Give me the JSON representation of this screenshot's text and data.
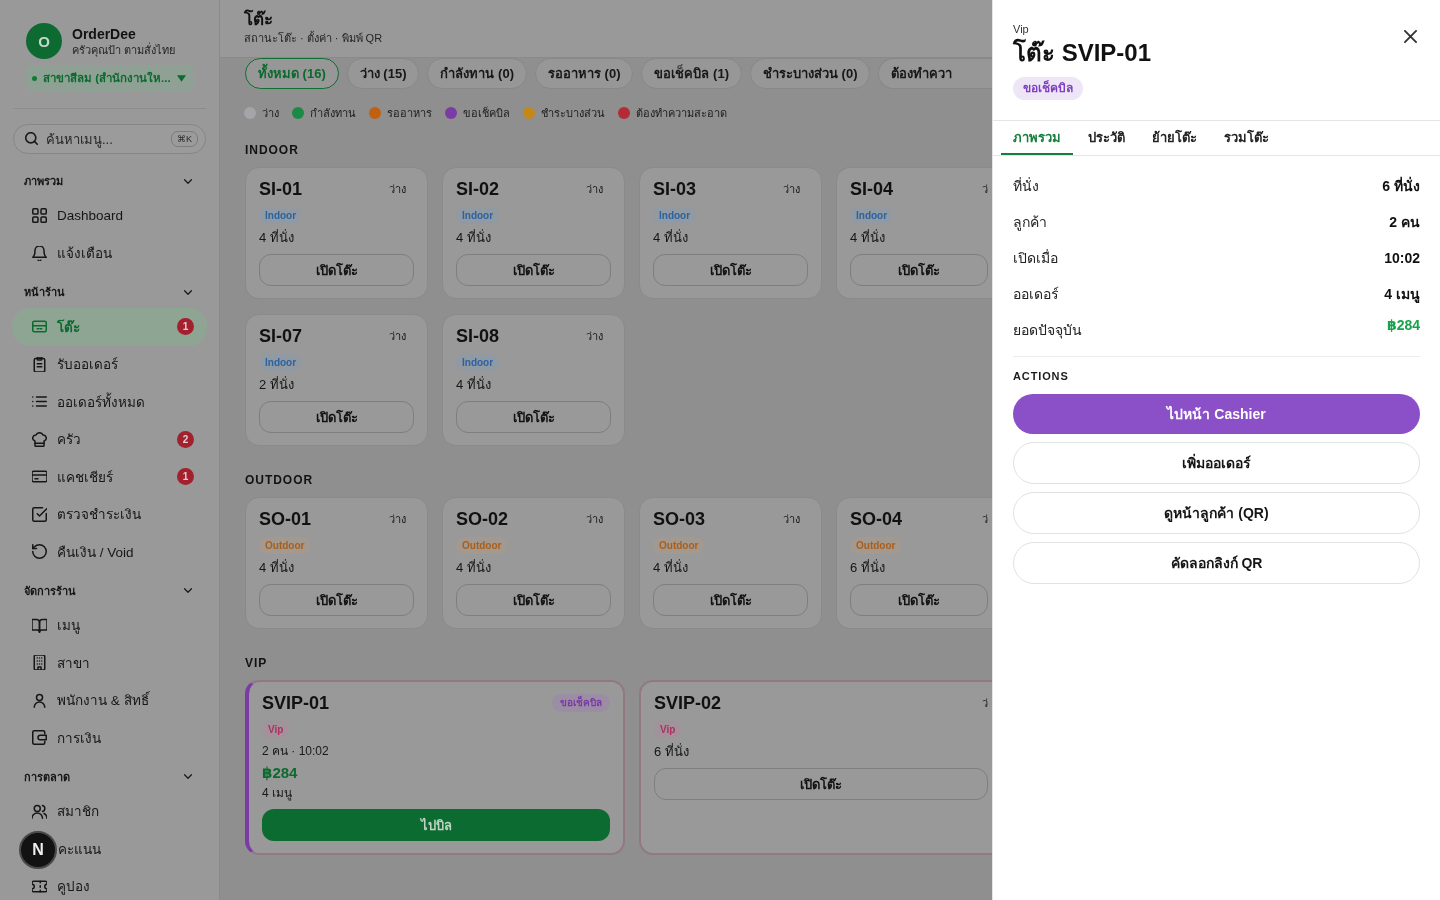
{
  "sidebar": {
    "brand": {
      "logo_letter": "O",
      "name": "OrderDee",
      "subtitle": "ครัวคุณป้า ตามสั่งไทย"
    },
    "branch": {
      "label": "สาขาสีลม (สำนักงานให..."
    },
    "search": {
      "placeholder": "ค้นหาเมนู...",
      "shortcut": "⌘K"
    },
    "sections": [
      {
        "title": "ภาพรวม",
        "expanded": true,
        "items": [
          {
            "label": "Dashboard",
            "selected": false
          },
          {
            "label": "แจ้งเตือน",
            "selected": false
          }
        ]
      },
      {
        "title": "หน้าร้าน",
        "expanded": true,
        "items": [
          {
            "label": "โต๊ะ",
            "selected": true,
            "badge": "1"
          },
          {
            "label": "รับออเดอร์",
            "selected": false
          },
          {
            "label": "ออเดอร์ทั้งหมด",
            "selected": false
          },
          {
            "label": "ครัว",
            "selected": false,
            "badge": "2"
          },
          {
            "label": "แคชเชียร์",
            "selected": false,
            "badge": "1"
          },
          {
            "label": "ตรวจชำระเงิน",
            "selected": false
          },
          {
            "label": "คืนเงิน / Void",
            "selected": false
          }
        ]
      },
      {
        "title": "จัดการร้าน",
        "expanded": true,
        "items": [
          {
            "label": "เมนู",
            "selected": false
          },
          {
            "label": "สาขา",
            "selected": false
          },
          {
            "label": "พนักงาน & สิทธิ์",
            "selected": false
          },
          {
            "label": "การเงิน",
            "selected": false
          }
        ]
      },
      {
        "title": "การตลาด",
        "expanded": true,
        "items": [
          {
            "label": "สมาชิก",
            "selected": false
          },
          {
            "label": "คะแนน",
            "selected": false
          },
          {
            "label": "คูปอง",
            "selected": false
          }
        ]
      }
    ]
  },
  "dev_tools": {
    "label": "N"
  },
  "header": {
    "title": "โต๊ะ",
    "subtitle": "สถานะโต๊ะ · ตั้งค่า · พิมพ์ QR"
  },
  "filters": [
    {
      "label": "ทั้งหมด (16)",
      "selected": true
    },
    {
      "label": "ว่าง (15)",
      "selected": false
    },
    {
      "label": "กำลังทาน (0)",
      "selected": false
    },
    {
      "label": "รออาหาร (0)",
      "selected": false
    },
    {
      "label": "ขอเช็คบิล (1)",
      "selected": false
    },
    {
      "label": "ชำระบางส่วน (0)",
      "selected": false
    },
    {
      "label": "ต้องทำควา",
      "selected": false
    }
  ],
  "legend": [
    {
      "label": "ว่าง",
      "color": "#a4a5a9"
    },
    {
      "label": "กำลังทาน",
      "color": "#1b8a44"
    },
    {
      "label": "รออาหาร",
      "color": "#c2600f"
    },
    {
      "label": "ขอเช็คบิล",
      "color": "#7b3ba6"
    },
    {
      "label": "ชำระบางส่วน",
      "color": "#c48718"
    },
    {
      "label": "ต้องทำความสะอาด",
      "color": "#b52a35"
    }
  ],
  "zones": [
    {
      "title": "INDOOR",
      "color": "#2b62a0",
      "featured": false,
      "tables": [
        {
          "kind": "available",
          "name": "SI-01",
          "status": "ว่าง",
          "tag": "Indoor",
          "seats": "4 ที่นั่ง",
          "action": "เปิดโต๊ะ"
        },
        {
          "kind": "available",
          "name": "SI-02",
          "status": "ว่าง",
          "tag": "Indoor",
          "seats": "4 ที่นั่ง",
          "action": "เปิดโต๊ะ"
        },
        {
          "kind": "available",
          "name": "SI-03",
          "status": "ว่าง",
          "tag": "Indoor",
          "seats": "4 ที่นั่ง",
          "action": "เปิดโต๊ะ"
        },
        {
          "kind": "available",
          "name": "SI-04",
          "status": "ว่",
          "tag": "Indoor",
          "seats": "4 ที่นั่ง",
          "action": "เปิดโต๊ะ"
        },
        {
          "kind": "available",
          "name": "SI-07",
          "status": "ว่าง",
          "tag": "Indoor",
          "seats": "2 ที่นั่ง",
          "action": "เปิดโต๊ะ"
        },
        {
          "kind": "available",
          "name": "SI-08",
          "status": "ว่าง",
          "tag": "Indoor",
          "seats": "4 ที่นั่ง",
          "action": "เปิดโต๊ะ"
        }
      ]
    },
    {
      "title": "OUTDOOR",
      "color": "#a95f1c",
      "featured": false,
      "tables": [
        {
          "kind": "available",
          "name": "SO-01",
          "status": "ว่าง",
          "tag": "Outdoor",
          "seats": "4 ที่นั่ง",
          "action": "เปิดโต๊ะ"
        },
        {
          "kind": "available",
          "name": "SO-02",
          "status": "ว่าง",
          "tag": "Outdoor",
          "seats": "4 ที่นั่ง",
          "action": "เปิดโต๊ะ"
        },
        {
          "kind": "available",
          "name": "SO-03",
          "status": "ว่าง",
          "tag": "Outdoor",
          "seats": "4 ที่นั่ง",
          "action": "เปิดโต๊ะ"
        },
        {
          "kind": "available",
          "name": "SO-04",
          "status": "ว่",
          "tag": "Outdoor",
          "seats": "6 ที่นั่ง",
          "action": "เปิดโต๊ะ"
        }
      ]
    },
    {
      "title": "VIP",
      "color": "#a8325f",
      "featured": true,
      "tables": [
        {
          "kind": "billing",
          "name": "SVIP-01",
          "status": "ขอเช็คบิล",
          "color": "#7b3ba6",
          "tag": "Vip",
          "guests": "2 คน · 10:02",
          "amount": "฿284",
          "orders": "4 เมนู",
          "action": "ไปบิล"
        },
        {
          "kind": "available",
          "name": "SVIP-02",
          "status": "ว่",
          "tag": "Vip",
          "seats": "6 ที่นั่ง",
          "action": "เปิดโต๊ะ"
        }
      ]
    }
  ],
  "drawer": {
    "zone": "Vip",
    "title": "โต๊ะ SVIP-01",
    "status": {
      "label": "ขอเช็คบิล",
      "color": "#7e3fbf"
    },
    "tabs": [
      {
        "label": "ภาพรวม",
        "selected": true
      },
      {
        "label": "ประวัติ",
        "selected": false
      },
      {
        "label": "ย้ายโต๊ะ",
        "selected": false
      },
      {
        "label": "รวมโต๊ะ",
        "selected": false
      }
    ],
    "details": [
      {
        "label": "ที่นั่ง",
        "value": "6 ที่นั่ง",
        "kind": "plain"
      },
      {
        "label": "ลูกค้า",
        "value": "2 คน",
        "kind": "plain"
      },
      {
        "label": "เปิดเมื่อ",
        "value": "10:02",
        "kind": "plain"
      },
      {
        "label": "ออเดอร์",
        "value": "4 เมนู",
        "kind": "plain"
      },
      {
        "label": "ยอดปัจจุบัน",
        "value": "฿284",
        "kind": "amount"
      }
    ],
    "actions_title": "ACTIONS",
    "actions": [
      {
        "label": "ไปหน้า Cashier",
        "kind": "primary"
      },
      {
        "label": "เพิ่มออเดอร์",
        "kind": "secondary"
      },
      {
        "label": "ดูหน้าลูกค้า (QR)",
        "kind": "secondary"
      },
      {
        "label": "คัดลอกลิงก์ QR",
        "kind": "secondary"
      }
    ]
  }
}
